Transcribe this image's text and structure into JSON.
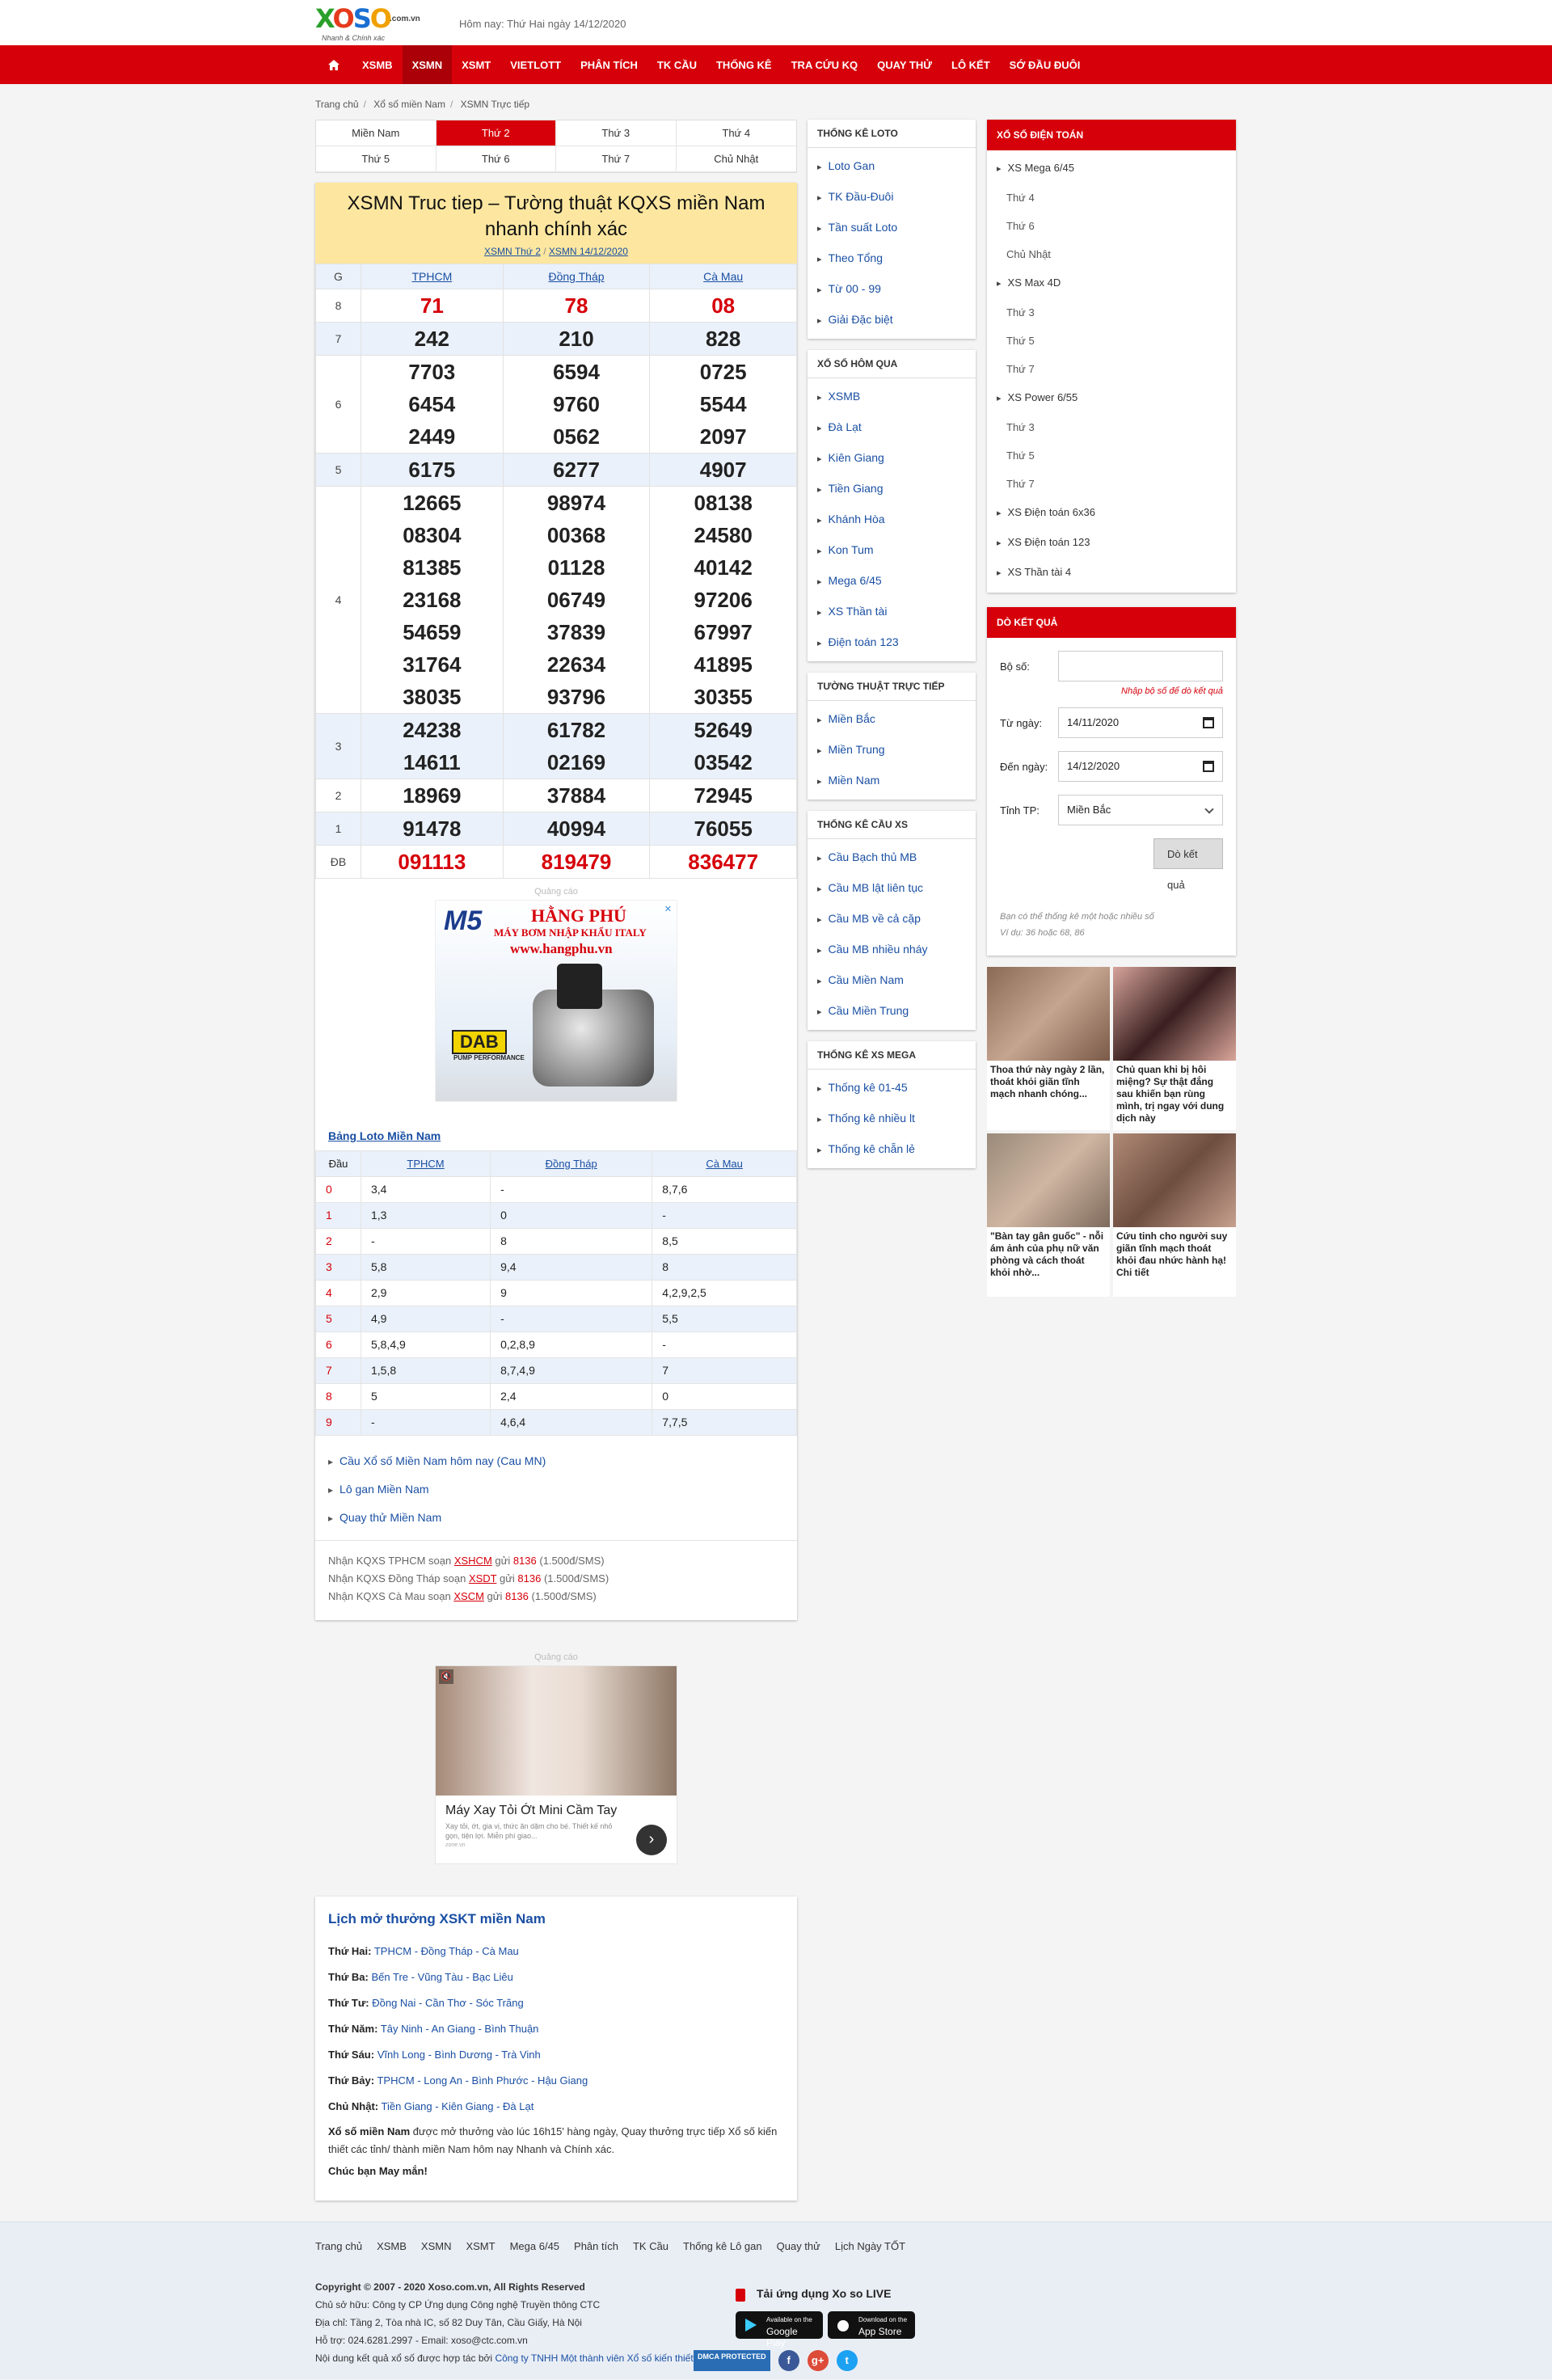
{
  "header": {
    "logo_text": "XOSO",
    "logo_domain": ".com.vn",
    "logo_tagline": "Nhanh & Chính xác",
    "today": "Hôm nay: Thứ Hai ngày 14/12/2020"
  },
  "nav": {
    "home_icon": "home-icon",
    "items": [
      "XSMB",
      "XSMN",
      "XSMT",
      "VIETLOTT",
      "PHÂN TÍCH",
      "TK CẦU",
      "THỐNG KÊ",
      "TRA CỨU KQ",
      "QUAY THỬ",
      "LÔ KẾT",
      "SỚ ĐẦU ĐUÔI"
    ],
    "active": "XSMN"
  },
  "breadcrumb": [
    "Trang chủ",
    "Xổ số miền Nam",
    "XSMN Trực tiếp"
  ],
  "day_tabs": [
    "Miền Nam",
    "Thứ 2",
    "Thứ 3",
    "Thứ 4",
    "Thứ 5",
    "Thứ 6",
    "Thứ 7",
    "Chủ Nhật"
  ],
  "result": {
    "title": "XSMN Truc tiep – Tường thuật KQXS miền Nam nhanh chính xác",
    "sub_link1": "XSMN Thứ 2",
    "sub_link2": "XSMN 14/12/2020",
    "col_label": "G",
    "provinces": [
      "TPHCM",
      "Đồng Tháp",
      "Cà Mau"
    ],
    "rows": [
      {
        "g": "8",
        "vals": [
          [
            "71"
          ],
          [
            "78"
          ],
          [
            "08"
          ]
        ],
        "red": true
      },
      {
        "g": "7",
        "vals": [
          [
            "242"
          ],
          [
            "210"
          ],
          [
            "828"
          ]
        ]
      },
      {
        "g": "6",
        "vals": [
          [
            "7703",
            "6454",
            "2449"
          ],
          [
            "6594",
            "9760",
            "0562"
          ],
          [
            "0725",
            "5544",
            "2097"
          ]
        ]
      },
      {
        "g": "5",
        "vals": [
          [
            "6175"
          ],
          [
            "6277"
          ],
          [
            "4907"
          ]
        ]
      },
      {
        "g": "4",
        "vals": [
          [
            "12665",
            "08304",
            "81385",
            "23168",
            "54659",
            "31764",
            "38035"
          ],
          [
            "98974",
            "00368",
            "01128",
            "06749",
            "37839",
            "22634",
            "93796"
          ],
          [
            "08138",
            "24580",
            "40142",
            "97206",
            "67997",
            "41895",
            "30355"
          ]
        ]
      },
      {
        "g": "3",
        "vals": [
          [
            "24238",
            "14611"
          ],
          [
            "61782",
            "02169"
          ],
          [
            "52649",
            "03542"
          ]
        ]
      },
      {
        "g": "2",
        "vals": [
          [
            "18969"
          ],
          [
            "37884"
          ],
          [
            "72945"
          ]
        ]
      },
      {
        "g": "1",
        "vals": [
          [
            "91478"
          ],
          [
            "40994"
          ],
          [
            "76055"
          ]
        ]
      },
      {
        "g": "ĐB",
        "vals": [
          [
            "091113"
          ],
          [
            "819479"
          ],
          [
            "836477"
          ]
        ],
        "red": true
      }
    ]
  },
  "ad1": {
    "label": "Quảng cáo",
    "brand": "HẰNG PHÚ",
    "line": "MÁY BƠM NHẬP KHẨU ITALY",
    "url": "www.hangphu.vn",
    "m5": "M5",
    "dab": "DAB",
    "dab_sub": "PUMP PERFORMANCE"
  },
  "loto": {
    "title": "Bảng Loto Miền Nam",
    "head": [
      "Đầu",
      "TPHCM",
      "Đồng Tháp",
      "Cà Mau"
    ],
    "rows": [
      [
        "0",
        "3,4",
        "-",
        "8,7,6"
      ],
      [
        "1",
        "1,3",
        "0",
        "-"
      ],
      [
        "2",
        "-",
        "8",
        "8,5"
      ],
      [
        "3",
        "5,8",
        "9,4",
        "8"
      ],
      [
        "4",
        "2,9",
        "9",
        "4,2,9,2,5"
      ],
      [
        "5",
        "4,9",
        "-",
        "5,5"
      ],
      [
        "6",
        "5,8,4,9",
        "0,2,8,9",
        "-"
      ],
      [
        "7",
        "1,5,8",
        "8,7,4,9",
        "7"
      ],
      [
        "8",
        "5",
        "2,4",
        "0"
      ],
      [
        "9",
        "-",
        "4,6,4",
        "7,7,5"
      ]
    ]
  },
  "links": [
    "Cầu Xổ số Miền Nam hôm nay (Cau MN)",
    "Lô gan Miền Nam",
    "Quay thử Miền Nam"
  ],
  "sms": [
    {
      "pre": "Nhận KQXS TPHCM soạn ",
      "code": "XSHCM",
      "mid": " gửi ",
      "num": "8136",
      "post": " (1.500đ/SMS)"
    },
    {
      "pre": "Nhận KQXS Đồng Tháp soạn ",
      "code": "XSDT",
      "mid": " gửi ",
      "num": "8136",
      "post": " (1.500đ/SMS)"
    },
    {
      "pre": "Nhận KQXS Cà Mau soạn ",
      "code": "XSCM",
      "mid": " gửi ",
      "num": "8136",
      "post": " (1.500đ/SMS)"
    }
  ],
  "ad2": {
    "label": "Quảng cáo",
    "title": "Máy Xay Tỏi Ớt Mini Cầm Tay",
    "desc": "Xay tỏi, ớt, gia vị, thức ăn dặm cho bé. Thiết kế nhỏ gọn, tiện lợi. Miễn phí giao...",
    "src": "zone.vn"
  },
  "schedule": {
    "title": "Lịch mở thưởng XSKT miền Nam",
    "rows": [
      {
        "day": "Thứ Hai:",
        "list": "TPHCM - Đồng Tháp - Cà Mau"
      },
      {
        "day": "Thứ Ba:",
        "list": "Bến Tre - Vũng Tàu - Bạc Liêu"
      },
      {
        "day": "Thứ Tư:",
        "list": "Đồng Nai - Cần Thơ - Sóc Trăng"
      },
      {
        "day": "Thứ Năm:",
        "list": "Tây Ninh - An Giang - Bình Thuận"
      },
      {
        "day": "Thứ Sáu:",
        "list": "Vĩnh Long - Bình Dương - Trà Vinh"
      },
      {
        "day": "Thứ Bảy:",
        "list": "TPHCM - Long An - Bình Phước - Hậu Giang"
      },
      {
        "day": "Chủ Nhật:",
        "list": "Tiền Giang - Kiên Giang - Đà Lạt"
      }
    ],
    "desc_bold": "Xổ số miền Nam",
    "desc": " được mở thưởng vào lúc 16h15' hàng ngày, Quay thưởng trực tiếp Xổ số kiến thiết các tỉnh/ thành miền Nam hôm nay Nhanh và Chính xác.",
    "wish": "Chúc bạn May mắn!"
  },
  "sidebar_mid": [
    {
      "title": "THỐNG KÊ LOTO",
      "items": [
        "Loto Gan",
        "TK Đầu-Đuôi",
        "Tần suất Loto",
        "Theo Tổng",
        "Từ 00 - 99",
        "Giải Đặc biệt"
      ]
    },
    {
      "title": "XỔ SỐ HÔM QUA",
      "items": [
        "XSMB",
        "Đà Lạt",
        "Kiên Giang",
        "Tiền Giang",
        "Khánh Hòa",
        "Kon Tum",
        "Mega 6/45",
        "XS Thần tài",
        "Điện toán 123"
      ]
    },
    {
      "title": "TƯỜNG THUẬT TRỰC TIẾP",
      "items": [
        "Miền Bắc",
        "Miền Trung",
        "Miền Nam"
      ]
    },
    {
      "title": "THỐNG KÊ CẦU XS",
      "items": [
        "Cầu Bạch thủ MB",
        "Cầu MB lật liên tục",
        "Cầu MB về cả cặp",
        "Cầu MB nhiều nháy",
        "Cầu Miền Nam",
        "Cầu Miền Trung"
      ]
    },
    {
      "title": "THỐNG KÊ XS MEGA",
      "items": [
        "Thống kê 01-45",
        "Thống kê nhiều lt",
        "Thống kê chẵn lẻ"
      ]
    }
  ],
  "dientoan": {
    "title": "XỔ SỐ ĐIỆN TOÁN",
    "groups": [
      {
        "name": "XS Mega 6/45",
        "subs": [
          "Thứ 4",
          "Thứ 6",
          "Chủ Nhật"
        ]
      },
      {
        "name": "XS Max 4D",
        "subs": [
          "Thứ 3",
          "Thứ 5",
          "Thứ 7"
        ]
      },
      {
        "name": "XS Power 6/55",
        "subs": [
          "Thứ 3",
          "Thứ 5",
          "Thứ 7"
        ]
      },
      {
        "name": "XS Điện toán 6x36",
        "subs": []
      },
      {
        "name": "XS Điện toán 123",
        "subs": []
      },
      {
        "name": "XS Thần tài 4",
        "subs": []
      }
    ]
  },
  "doketqua": {
    "title": "DÒ KẾT QUẢ",
    "so_label": "Bộ số:",
    "so_value": "",
    "hint": "Nhập bộ số để dò kết quả",
    "from_label": "Từ ngày:",
    "from_value": "14/11/2020",
    "to_label": "Đến ngày:",
    "to_value": "14/12/2020",
    "prov_label": "Tỉnh TP:",
    "prov_value": "Miền Bắc",
    "button": "Dò kết quả",
    "note1": "Bạn có thể thống kê một hoặc nhiều số",
    "note2": "Ví dụ: 36 hoặc 68, 86"
  },
  "ads_right": [
    "Thoa thứ này ngày 2 lần, thoát khỏi giãn tĩnh mạch nhanh chóng...",
    "Chủ quan khi bị hôi miệng? Sự thật đắng sau khiến bạn rùng mình, trị ngay với dung dịch này",
    "\"Bàn tay gân guốc\" - nỗi ám ảnh của phụ nữ văn phòng và cách thoát khỏi nhờ...",
    "Cứu tinh cho người suy giãn tĩnh mạch thoát khỏi đau nhức hành hạ! Chi tiết"
  ],
  "footer": {
    "links": [
      "Trang chủ",
      "XSMB",
      "XSMN",
      "XSMT",
      "Mega 6/45",
      "Phân tích",
      "TK Cầu",
      "Thống kê Lô gan",
      "Quay thử",
      "Lịch Ngày TỐT"
    ],
    "copyright": "Copyright © 2007 - 2020 Xoso.com.vn, All Rights Reserved",
    "owner": "Chủ sở hữu: Công ty CP Ứng dụng Công nghệ Truyền thông CTC",
    "address": "Địa chỉ: Tầng 2, Tòa nhà IC, số 82 Duy Tân, Cầu Giấy, Hà Nội",
    "contact": "Hỗ trợ: 024.6281.2997 - Email: xoso@ctc.com.vn",
    "coop_pre": "Nội dung kết quả xổ số được hợp tác bởi ",
    "coop_link": "Công ty TNHH Một thành viên Xổ số kiến thiết Thủ đô.",
    "app_title": "Tải ứng dụng Xo so LIVE",
    "gp_small": "Available on the",
    "gp": "Google Play",
    "as_small": "Download on the",
    "as": "App Store",
    "dmca": "DMCA PROTECTED",
    "social": [
      "f",
      "g+",
      "t"
    ]
  }
}
